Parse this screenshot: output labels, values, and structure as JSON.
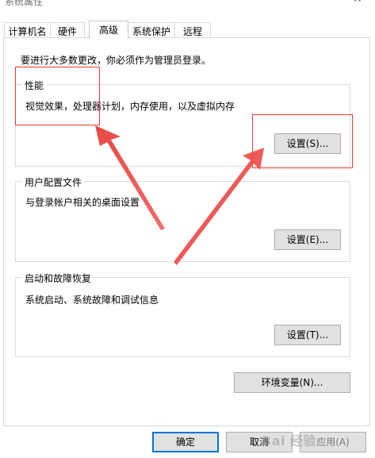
{
  "window": {
    "title": "系统属性",
    "close_glyph": "✕"
  },
  "tabs": [
    {
      "label": "计算机名",
      "active": false
    },
    {
      "label": "硬件",
      "active": false
    },
    {
      "label": "高级",
      "active": true
    },
    {
      "label": "系统保护",
      "active": false
    },
    {
      "label": "远程",
      "active": false
    }
  ],
  "admin_note": "要进行大多数更改，你必须作为管理员登录。",
  "groups": {
    "performance": {
      "label": "性能",
      "description": "视觉效果，处理器计划，内存使用，以及虚拟内存",
      "button": "设置(S)..."
    },
    "user_profiles": {
      "label": "用户配置文件",
      "description": "与登录帐户相关的桌面设置",
      "button": "设置(E)..."
    },
    "startup_recovery": {
      "label": "启动和故障恢复",
      "description": "系统启动、系统故障和调试信息",
      "button": "设置(T)..."
    }
  },
  "env_button": "环境变量(N)...",
  "footer": {
    "ok": "确定",
    "cancel": "取消",
    "apply": "应用(A)"
  },
  "watermark": "Bai 经验",
  "colors": {
    "annotation_red": "#e53935",
    "focus_blue": "#0078d7",
    "button_face": "#e1e1e1"
  }
}
